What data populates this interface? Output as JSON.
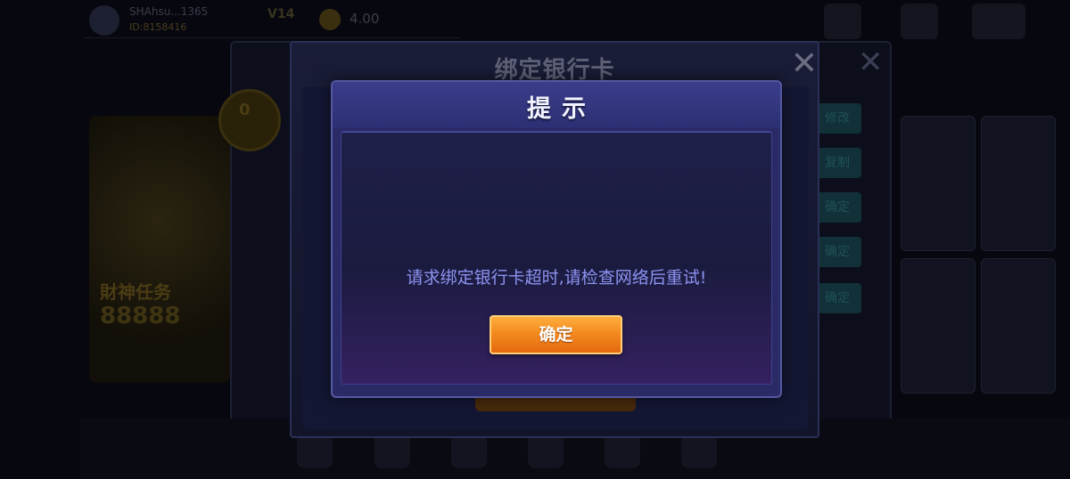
{
  "background": {
    "player_name": "SHAhsu...1365",
    "player_id": "ID:8158416",
    "vip": "V14",
    "coins": "4.00",
    "medal_count": "0",
    "left_panel_title": "財神任务",
    "left_panel_value": "88888",
    "side_buttons": [
      "修改",
      "复制",
      "确定",
      "确定",
      "确定"
    ]
  },
  "bind_dialog": {
    "title": "绑定银行卡",
    "close_icon": "close-icon"
  },
  "alert": {
    "title": "提示",
    "message": "请求绑定银行卡超时,请检查网络后重试!",
    "confirm_label": "确定"
  },
  "colors": {
    "alert_bg": "#2a2a66",
    "message_text": "#8c93f0",
    "confirm_button": "#f28a1e"
  }
}
